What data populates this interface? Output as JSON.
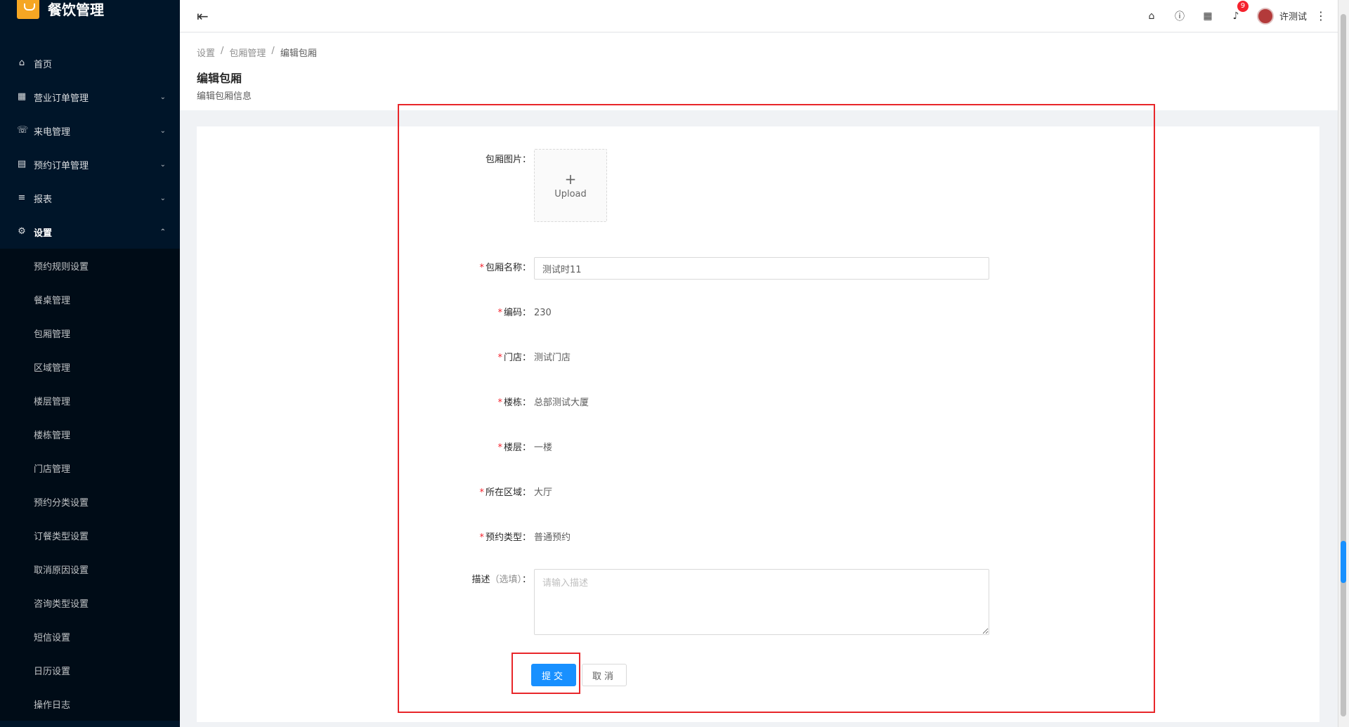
{
  "app": {
    "title": "餐饮管理",
    "logo_icon": "bowl-icon"
  },
  "sidebar": {
    "items": [
      {
        "label": "首页",
        "icon": "home-icon",
        "glyph": "⌂"
      },
      {
        "label": "营业订单管理",
        "icon": "order-icon",
        "glyph": "▦",
        "has_arrow": true
      },
      {
        "label": "来电管理",
        "icon": "phone-icon",
        "glyph": "☏",
        "has_arrow": true
      },
      {
        "label": "预约订单管理",
        "icon": "list-icon",
        "glyph": "▤",
        "has_arrow": true
      },
      {
        "label": "报表",
        "icon": "menu-icon",
        "glyph": "≡",
        "has_arrow": true
      },
      {
        "label": "设置",
        "icon": "gear-icon",
        "glyph": "⚙",
        "has_arrow": true,
        "expanded": true
      }
    ],
    "submenu": [
      "预约规则设置",
      "餐桌管理",
      "包厢管理",
      "区域管理",
      "楼层管理",
      "楼栋管理",
      "门店管理",
      "预约分类设置",
      "订餐类型设置",
      "取消原因设置",
      "咨询类型设置",
      "短信设置",
      "日历设置",
      "操作日志"
    ]
  },
  "header": {
    "notification_count": "9",
    "user_name": "许测试"
  },
  "breadcrumb": {
    "items": [
      "设置",
      "包厢管理"
    ],
    "current": "编辑包厢",
    "separator": "/"
  },
  "page": {
    "title": "编辑包厢",
    "description": "编辑包厢信息"
  },
  "form": {
    "image_label": "包厢图片：",
    "upload_plus": "+",
    "upload_text": "Upload",
    "name_label": "包厢名称：",
    "name_value": "测试时11",
    "code_label": "编码：",
    "code_value": "230",
    "store_label": "门店：",
    "store_value": "测试门店",
    "building_label": "楼栋：",
    "building_value": "总部测试大厦",
    "floor_label": "楼层：",
    "floor_value": "一楼",
    "area_label": "所在区域：",
    "area_value": "大厅",
    "type_label": "预约类型：",
    "type_value": "普通预约",
    "desc_label": "描述",
    "desc_optional": "（选填）",
    "desc_colon": "：",
    "desc_placeholder": "请输入描述",
    "required_mark": "*",
    "submit_label": "提交",
    "cancel_label": "取消"
  },
  "colors": {
    "sidebar_bg": "#001529",
    "primary": "#1890ff",
    "annotation": "#e8262a",
    "badge": "#f5222d"
  }
}
